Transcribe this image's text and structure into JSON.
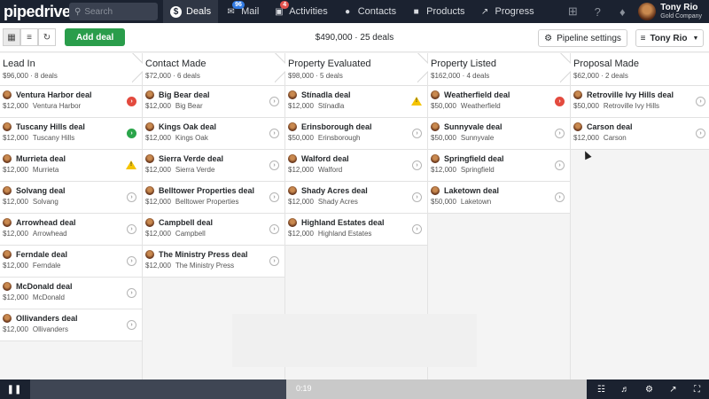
{
  "app": {
    "logo": "pipedrive"
  },
  "search": {
    "placeholder": "Search"
  },
  "nav": [
    {
      "label": "Deals",
      "icon": "dollar-icon",
      "active": true,
      "badge": ""
    },
    {
      "label": "Mail",
      "icon": "mail-icon",
      "badge": "96"
    },
    {
      "label": "Activities",
      "icon": "calendar-icon",
      "badge": "4"
    },
    {
      "label": "Contacts",
      "icon": "person-icon",
      "badge": ""
    },
    {
      "label": "Products",
      "icon": "box-icon",
      "badge": ""
    },
    {
      "label": "Progress",
      "icon": "trend-icon",
      "badge": ""
    }
  ],
  "user": {
    "name": "Tony Rio",
    "company": "Gold Company"
  },
  "toolbar": {
    "add_deal": "Add deal",
    "summary": "$490,000 · 25 deals",
    "pipeline_settings": "Pipeline settings",
    "owner": "Tony Rio"
  },
  "stages": [
    {
      "name": "Lead In",
      "meta": "$96,000 · 8 deals",
      "deals": [
        {
          "title": "Ventura Harbor deal",
          "value": "$12,000",
          "org": "Ventura Harbor",
          "status": "red"
        },
        {
          "title": "Tuscany Hills deal",
          "value": "$12,000",
          "org": "Tuscany Hills",
          "status": "green"
        },
        {
          "title": "Murrieta deal",
          "value": "$12,000",
          "org": "Murrieta",
          "status": "warn"
        },
        {
          "title": "Solvang deal",
          "value": "$12,000",
          "org": "Solvang",
          "status": "grey"
        },
        {
          "title": "Arrowhead deal",
          "value": "$12,000",
          "org": "Arrowhead",
          "status": "grey"
        },
        {
          "title": "Ferndale deal",
          "value": "$12,000",
          "org": "Ferndale",
          "status": "grey"
        },
        {
          "title": "McDonald deal",
          "value": "$12,000",
          "org": "McDonald",
          "status": "grey"
        },
        {
          "title": "Ollivanders deal",
          "value": "$12,000",
          "org": "Ollivanders",
          "status": "grey"
        }
      ]
    },
    {
      "name": "Contact Made",
      "meta": "$72,000 · 6 deals",
      "deals": [
        {
          "title": "Big Bear deal",
          "value": "$12,000",
          "org": "Big Bear",
          "status": "grey"
        },
        {
          "title": "Kings Oak deal",
          "value": "$12,000",
          "org": "Kings Oak",
          "status": "grey"
        },
        {
          "title": "Sierra Verde deal",
          "value": "$12,000",
          "org": "Sierra Verde",
          "status": "grey"
        },
        {
          "title": "Belltower Properties deal",
          "value": "$12,000",
          "org": "Belltower Properties",
          "status": "grey"
        },
        {
          "title": "Campbell deal",
          "value": "$12,000",
          "org": "Campbell",
          "status": "grey"
        },
        {
          "title": "The Ministry Press deal",
          "value": "$12,000",
          "org": "The Ministry Press",
          "status": "grey"
        }
      ]
    },
    {
      "name": "Property Evaluated",
      "meta": "$98,000 · 5 deals",
      "deals": [
        {
          "title": "Stínadla deal",
          "value": "$12,000",
          "org": "Stínadla",
          "status": "warn"
        },
        {
          "title": "Erinsborough deal",
          "value": "$50,000",
          "org": "Erinsborough",
          "status": "grey"
        },
        {
          "title": "Walford deal",
          "value": "$12,000",
          "org": "Walford",
          "status": "grey"
        },
        {
          "title": "Shady Acres deal",
          "value": "$12,000",
          "org": "Shady Acres",
          "status": "grey"
        },
        {
          "title": "Highland Estates deal",
          "value": "$12,000",
          "org": "Highland Estates",
          "status": "grey"
        }
      ]
    },
    {
      "name": "Property Listed",
      "meta": "$162,000 · 4 deals",
      "deals": [
        {
          "title": "Weatherfield deal",
          "value": "$50,000",
          "org": "Weatherfield",
          "status": "red"
        },
        {
          "title": "Sunnyvale deal",
          "value": "$50,000",
          "org": "Sunnyvale",
          "status": "grey"
        },
        {
          "title": "Springfield deal",
          "value": "$12,000",
          "org": "Springfield",
          "status": "grey"
        },
        {
          "title": "Laketown deal",
          "value": "$50,000",
          "org": "Laketown",
          "status": "grey"
        }
      ]
    },
    {
      "name": "Proposal Made",
      "meta": "$62,000 · 2 deals",
      "deals": [
        {
          "title": "Retroville Ivy Hills deal",
          "value": "$50,000",
          "org": "Retroville Ivy Hills",
          "status": "grey"
        },
        {
          "title": "Carson deal",
          "value": "$12,000",
          "org": "Carson",
          "status": "grey"
        }
      ]
    }
  ],
  "player": {
    "time": "0:19",
    "progress": 0.46
  }
}
